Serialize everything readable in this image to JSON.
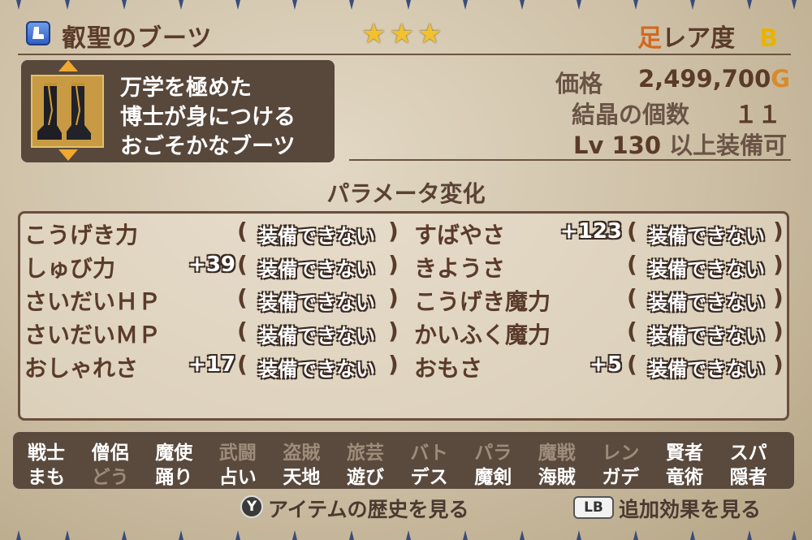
{
  "item": {
    "name": "叡聖のブーツ",
    "stars": "★★★",
    "rarity_slot": "足",
    "rarity_label": "レア度",
    "rarity_grade": "B",
    "description": [
      "万学を極めた",
      "博士が身につける",
      "おごそかなブーツ"
    ]
  },
  "meta": {
    "price_label": "価格",
    "price_value": "2,499,700",
    "price_unit": "G",
    "crystal_label": "結晶の個数",
    "crystal_value": "１１",
    "level_prefix": "Lv",
    "level_value": "130",
    "level_suffix": "以上装備可"
  },
  "params": {
    "title": "パラメータ変化",
    "left": [
      {
        "name": "こうげき力",
        "bonus": "",
        "status": "装備できない"
      },
      {
        "name": "しゅび力",
        "bonus": "+39",
        "status": "装備できない"
      },
      {
        "name": "さいだいＨＰ",
        "bonus": "",
        "status": "装備できない"
      },
      {
        "name": "さいだいＭＰ",
        "bonus": "",
        "status": "装備できない"
      },
      {
        "name": "おしゃれさ",
        "bonus": "+17",
        "status": "装備できない"
      }
    ],
    "right": [
      {
        "name": "すばやさ",
        "bonus": "+123",
        "status": "装備できない"
      },
      {
        "name": "きようさ",
        "bonus": "",
        "status": "装備できない"
      },
      {
        "name": "こうげき魔力",
        "bonus": "",
        "status": "装備できない"
      },
      {
        "name": "かいふく魔力",
        "bonus": "",
        "status": "装備できない"
      },
      {
        "name": "おもさ",
        "bonus": "+5",
        "status": "装備できない"
      }
    ],
    "paren_open": "(",
    "paren_close": ")"
  },
  "jobs": {
    "row1": [
      {
        "label": "戦士",
        "on": true
      },
      {
        "label": "僧侶",
        "on": true
      },
      {
        "label": "魔使",
        "on": true
      },
      {
        "label": "武闘",
        "on": false
      },
      {
        "label": "盗賊",
        "on": false
      },
      {
        "label": "旅芸",
        "on": false
      },
      {
        "label": "バト",
        "on": false
      },
      {
        "label": "パラ",
        "on": false
      },
      {
        "label": "魔戦",
        "on": false
      },
      {
        "label": "レン",
        "on": false
      },
      {
        "label": "賢者",
        "on": true
      },
      {
        "label": "スパ",
        "on": true
      }
    ],
    "row2": [
      {
        "label": "まも",
        "on": true
      },
      {
        "label": "どう",
        "on": false
      },
      {
        "label": "踊り",
        "on": true
      },
      {
        "label": "占い",
        "on": true
      },
      {
        "label": "天地",
        "on": true
      },
      {
        "label": "遊び",
        "on": true
      },
      {
        "label": "デス",
        "on": true
      },
      {
        "label": "魔剣",
        "on": true
      },
      {
        "label": "海賊",
        "on": true
      },
      {
        "label": "ガデ",
        "on": true
      },
      {
        "label": "竜術",
        "on": true
      },
      {
        "label": "隠者",
        "on": true
      }
    ]
  },
  "footer": {
    "y_button": "Y",
    "y_label": "アイテムの歴史を見る",
    "lb_button": "LB",
    "lb_label": "追加効果を見る"
  },
  "colors": {
    "panel": "#cdbfa5",
    "dark_box": "#58473b",
    "text": "#5a3b2a",
    "star": "#f2c22e",
    "accent_orange": "#d98a2a"
  },
  "icons": [
    "boot-slot-icon",
    "star-icon",
    "up-arrow-icon",
    "down-arrow-icon",
    "y-button-icon",
    "lb-button-icon"
  ]
}
